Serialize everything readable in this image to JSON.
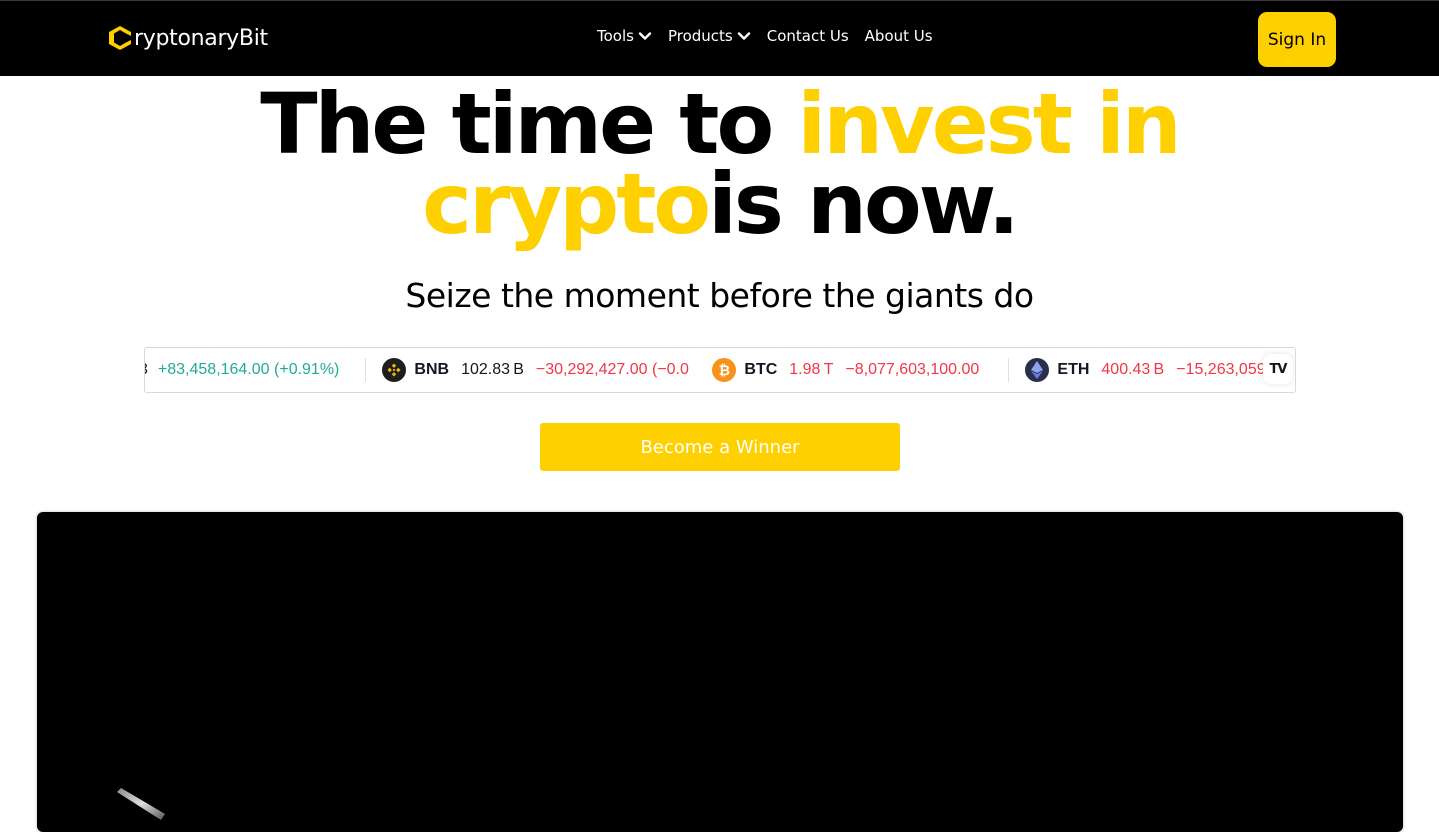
{
  "header": {
    "logo_text": "ryptonaryBit",
    "logo_mark": "C",
    "nav": [
      {
        "label": "Tools",
        "has_dropdown": true
      },
      {
        "label": "Products",
        "has_dropdown": true
      },
      {
        "label": "Contact Us",
        "has_dropdown": false
      },
      {
        "label": "About Us",
        "has_dropdown": false
      }
    ],
    "sign_in_label": "Sign In"
  },
  "hero": {
    "line1_black": "The time to ",
    "line1_yellow": "invest in",
    "line2_yellow": "crypto",
    "line2_black": "is now.",
    "subtitle": "Seize the moment before the giants do",
    "cta_label": "Become a Winner"
  },
  "ticker": {
    "items": [
      {
        "symbol": "",
        "cap": "3",
        "change": "+83,458,164.00 (+0.91%)",
        "direction": "up"
      },
      {
        "symbol": "BNB",
        "cap": "102.83 B",
        "change": "−30,292,427.00 (−0.0",
        "direction": "down",
        "icon": "bnb-icon",
        "color": "#f0b90b"
      },
      {
        "symbol": "BTC",
        "cap": "1.98 T",
        "change": "−8,077,603,100.00",
        "direction": "down",
        "icon": "bitcoin-icon",
        "color": "#f7931a",
        "cap_color": "#f23645"
      },
      {
        "symbol": "ETH",
        "cap": "400.43 B",
        "change": "−15,263,059",
        "direction": "down",
        "icon": "ethereum-icon",
        "color": "#627eea",
        "cap_color": "#f23645"
      }
    ],
    "badge": "TV"
  },
  "colors": {
    "accent": "#ffd000",
    "header_bg": "#000000",
    "positive": "#22ab94",
    "negative": "#f23645"
  }
}
